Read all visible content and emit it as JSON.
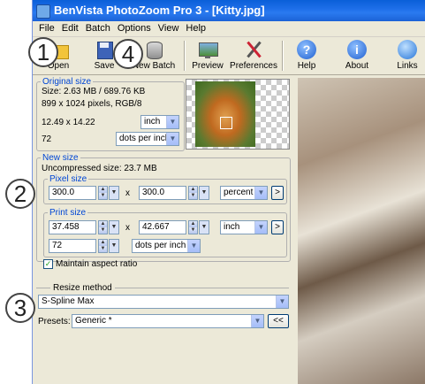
{
  "window": {
    "title": "BenVista PhotoZoom Pro 3 - [Kitty.jpg]"
  },
  "menu": [
    "File",
    "Edit",
    "Batch",
    "Options",
    "View",
    "Help"
  ],
  "toolbar": {
    "open": "Open",
    "save": "Save",
    "new_batch": "New Batch",
    "preview": "Preview",
    "preferences": "Preferences",
    "help": "Help",
    "about": "About",
    "links": "Links"
  },
  "original": {
    "legend": "Original size",
    "size": "Size: 2.63 MB / 689.76 KB",
    "pixels": "899 x 1024 pixels, RGB/8",
    "dims": "12.49 x 14.22",
    "unit": "inch",
    "res": "72",
    "res_unit": "dots per inch"
  },
  "new_size": {
    "legend": "New size",
    "uncompressed": "Uncompressed size: 23.7 MB",
    "pixel": {
      "legend": "Pixel size",
      "width": "300.0",
      "times": "x",
      "height": "300.0",
      "unit": "percent",
      "arrow": ">"
    },
    "print": {
      "legend": "Print size",
      "width": "37.458",
      "times": "x",
      "height": "42.667",
      "unit": "inch",
      "arrow": ">",
      "res": "72",
      "res_unit": "dots per inch"
    },
    "maintain": "Maintain aspect ratio",
    "maintain_checked": true
  },
  "resize": {
    "legend": "Resize method",
    "method": "S-Spline Max",
    "presets_label": "Presets:",
    "preset": "Generic *",
    "back_button": "<<"
  },
  "callouts": {
    "c1": "1",
    "c2": "2",
    "c3": "3",
    "c4": "4"
  }
}
